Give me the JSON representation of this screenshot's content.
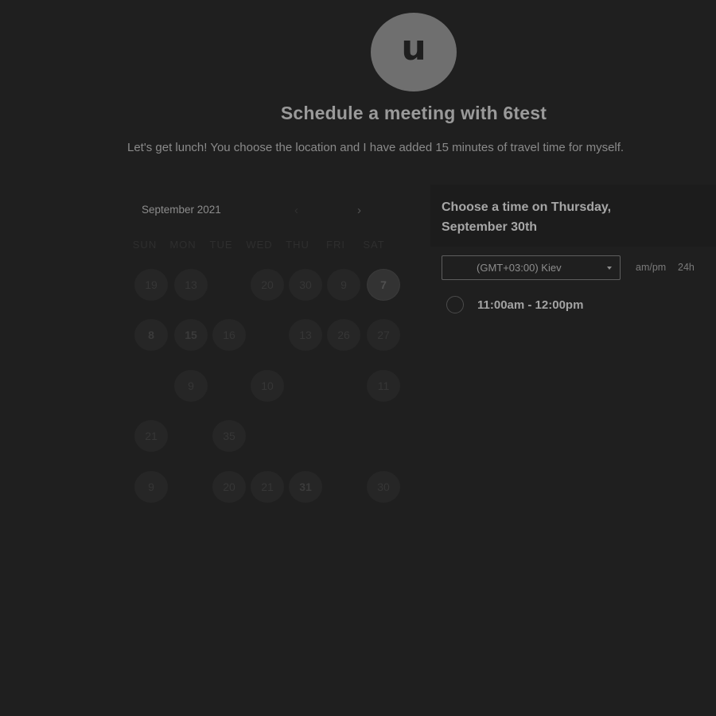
{
  "avatar": {
    "initial": "u"
  },
  "header": {
    "title": "Schedule a meeting with 6test",
    "description": "Let's get lunch! You choose the location and I have added 15 minutes of travel time for myself."
  },
  "calendar": {
    "month_label": "September 2021",
    "prev_icon": "‹",
    "next_icon": "›",
    "weekdays": [
      "SUN",
      "MON",
      "TUE",
      "WED",
      "THU",
      "FRI",
      "SAT"
    ],
    "days": [
      "19",
      "13",
      "20",
      "30",
      "9",
      "7",
      "8",
      "15",
      "16",
      "13",
      "26",
      "27",
      "9",
      "10",
      "11",
      "21",
      "35",
      "9",
      "20",
      "21",
      "31",
      "30"
    ]
  },
  "times": {
    "heading": "Choose a time on Thursday, September 30th",
    "timezone": "(GMT+03:00) Kiev",
    "format_ampm": "am/pm",
    "format_24h": "24h",
    "slots": [
      {
        "label": "11:00am - 12:00pm"
      }
    ]
  },
  "colors": {
    "background": "#1f1f1f",
    "avatar": "#6f6f6f",
    "text_primary": "#a7a7a7"
  }
}
